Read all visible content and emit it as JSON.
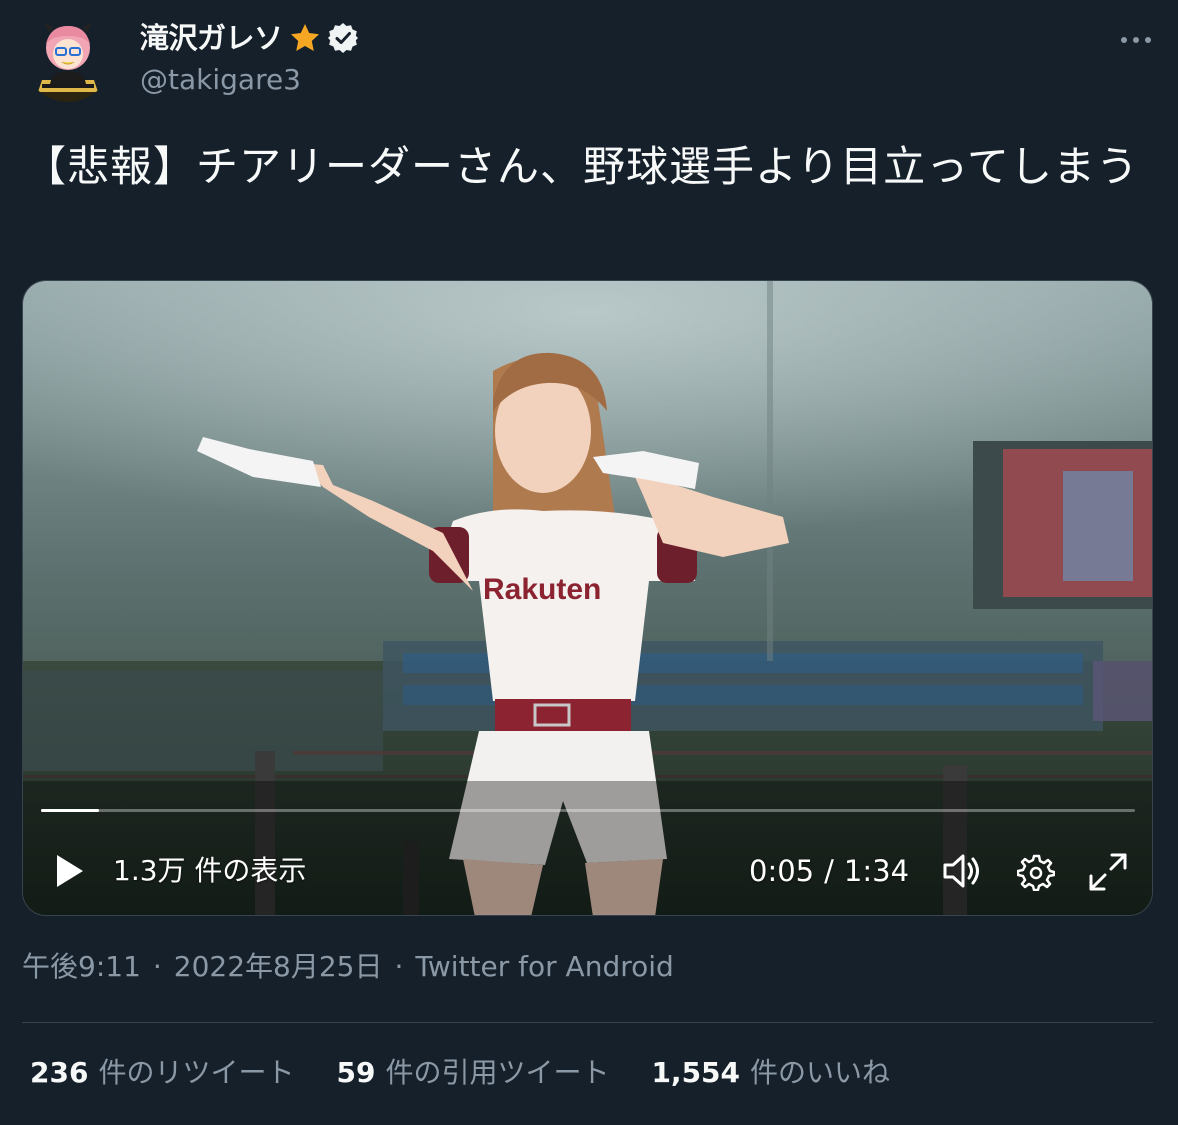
{
  "author": {
    "display_name": "滝沢ガレソ",
    "handle": "@takigare3",
    "badge_icons": [
      "star-icon",
      "verified-icon"
    ],
    "badge_color": "#f5a623"
  },
  "tweet": {
    "text": "【悲報】チアリーダーさん、野球選手より目立ってしまう"
  },
  "video": {
    "views": "1.3万 件の表示",
    "current_time": "0:05",
    "separator": "/",
    "duration": "1:34",
    "progress_fraction": 0.053,
    "jersey_text": "Rakuten"
  },
  "meta": {
    "time": "午後9:11",
    "dot1": "·",
    "date": "2022年8月25日",
    "dot2": "·",
    "source": "Twitter for Android"
  },
  "stats": {
    "retweets": {
      "count": "236",
      "label": "件のリツイート"
    },
    "quotes": {
      "count": "59",
      "label": "件の引用ツイート"
    },
    "likes": {
      "count": "1,554",
      "label": "件のいいね"
    }
  },
  "colors": {
    "background": "#15202b",
    "text_primary": "#f7f9f9",
    "text_secondary": "#8b98a5",
    "border": "#38444d"
  }
}
